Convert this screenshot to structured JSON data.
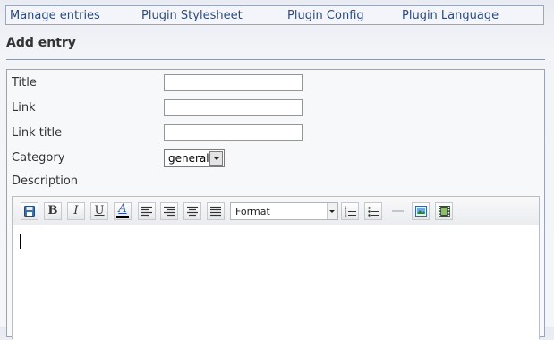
{
  "nav": {
    "items": [
      {
        "label": "Manage entries"
      },
      {
        "label": "Plugin Stylesheet"
      },
      {
        "label": "Plugin Config"
      },
      {
        "label": "Plugin Language"
      }
    ]
  },
  "heading": "Add entry",
  "form": {
    "title_label": "Title",
    "title_value": "",
    "link_label": "Link",
    "link_value": "",
    "link_title_label": "Link title",
    "link_title_value": "",
    "category_label": "Category",
    "category_value": "general",
    "description_label": "Description"
  },
  "editor": {
    "format_value": "Format",
    "toolbar_icons": [
      "save-icon",
      "bold-icon",
      "italic-icon",
      "underline-icon",
      "font-color-icon",
      "align-left-icon",
      "align-right-icon",
      "align-center-icon",
      "align-justify-icon",
      "ordered-list-icon",
      "unordered-list-icon",
      "horizontal-rule-icon",
      "image-icon",
      "media-icon"
    ],
    "bold_glyph": "B",
    "italic_glyph": "I",
    "underline_glyph": "U",
    "font_color_glyph": "A",
    "font_color_swatch": "#000000"
  },
  "colors": {
    "nav_link": "#2e4a78",
    "nav_border": "#9aa7bd",
    "page_background": "#f2f4f8"
  }
}
